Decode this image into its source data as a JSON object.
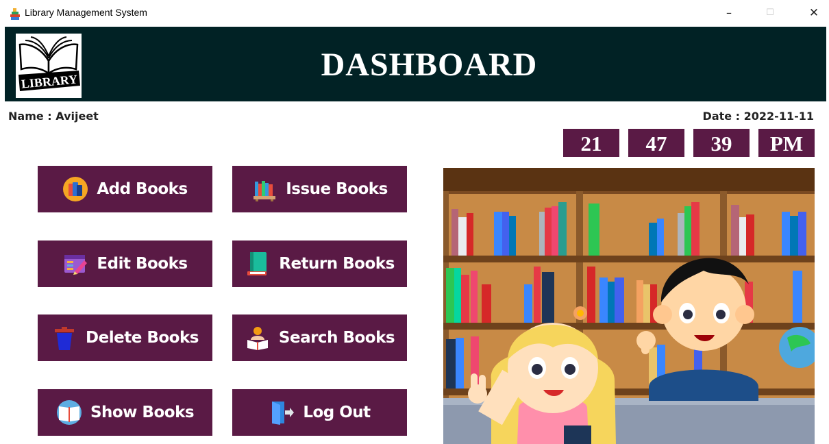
{
  "window": {
    "title": "Library Management System",
    "minimize": "–",
    "maximize": "☐",
    "close": "✕"
  },
  "header": {
    "logo_text": "LIBRARY",
    "title": "DASHBOARD"
  },
  "info": {
    "name_label": "Name :  Avijeet",
    "date_label": "Date :  2022-11-11"
  },
  "clock": {
    "hours": "21",
    "minutes": "47",
    "seconds": "39",
    "period": "PM"
  },
  "buttons": {
    "add_books": "Add Books",
    "issue_books": "Issue Books",
    "edit_books": "Edit Books",
    "return_books": "Return Books",
    "delete_books": "Delete Books",
    "search_books": "Search Books",
    "show_books": "Show Books",
    "log_out": "Log Out"
  },
  "colors": {
    "header_bg": "#012225",
    "button_bg": "#5a1a45",
    "button_text": "#ffffff"
  },
  "icons": {
    "app": "books-app-icon",
    "add_books": "book-stack-icon",
    "issue_books": "bookshelf-icon",
    "edit_books": "edit-window-icon",
    "return_books": "teal-book-icon",
    "delete_books": "trash-can-icon",
    "search_books": "reading-person-icon",
    "show_books": "open-book-icon",
    "log_out": "door-exit-icon"
  }
}
